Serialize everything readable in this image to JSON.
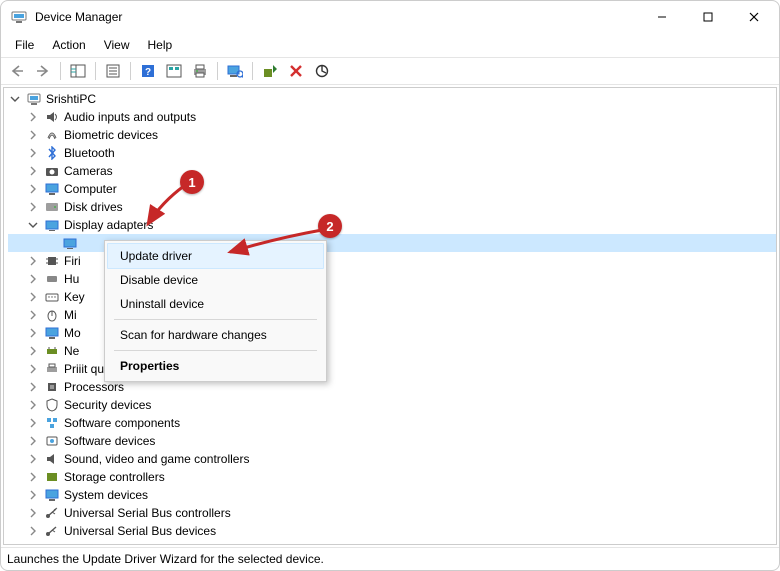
{
  "window": {
    "title": "Device Manager"
  },
  "menu": {
    "file": "File",
    "action": "Action",
    "view": "View",
    "help": "Help"
  },
  "tree": {
    "root": "SrishtiPC",
    "items": [
      "Audio inputs and outputs",
      "Biometric devices",
      "Bluetooth",
      "Cameras",
      "Computer",
      "Disk drives",
      "Display adapters",
      "Firi",
      "Hu",
      "Key",
      "Mi",
      "Mo",
      "Ne",
      "Prii",
      "Processors",
      "Security devices",
      "Software components",
      "Software devices",
      "Sound, video and game controllers",
      "Storage controllers",
      "System devices",
      "Universal Serial Bus controllers",
      "Universal Serial Bus devices"
    ],
    "prii_tail": "it queues"
  },
  "context": {
    "update": "Update driver",
    "disable": "Disable device",
    "uninstall": "Uninstall device",
    "scan": "Scan for hardware changes",
    "properties": "Properties"
  },
  "status": "Launches the Update Driver Wizard for the selected device.",
  "callouts": {
    "c1": "1",
    "c2": "2"
  }
}
